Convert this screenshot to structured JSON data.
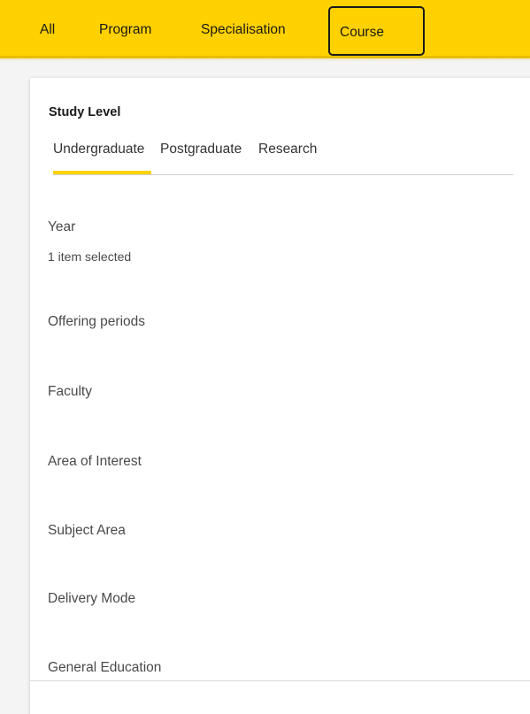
{
  "nav": {
    "tabs": {
      "all": "All",
      "program": "Program",
      "specialisation": "Specialisation",
      "course": "Course"
    },
    "active_tab": "Course",
    "accent_color": "#ffd100"
  },
  "filters": {
    "study_level": {
      "title": "Study Level",
      "options": {
        "undergraduate": "Undergraduate",
        "postgraduate": "Postgraduate",
        "research": "Research"
      },
      "selected": "Undergraduate"
    },
    "year": {
      "label": "Year",
      "status": "1 item selected"
    },
    "offering_periods": {
      "label": "Offering periods"
    },
    "faculty": {
      "label": "Faculty"
    },
    "area_of_interest": {
      "label": "Area of Interest"
    },
    "subject_area": {
      "label": "Subject Area"
    },
    "delivery_mode": {
      "label": "Delivery Mode"
    },
    "general_education": {
      "label": "General Education"
    }
  }
}
